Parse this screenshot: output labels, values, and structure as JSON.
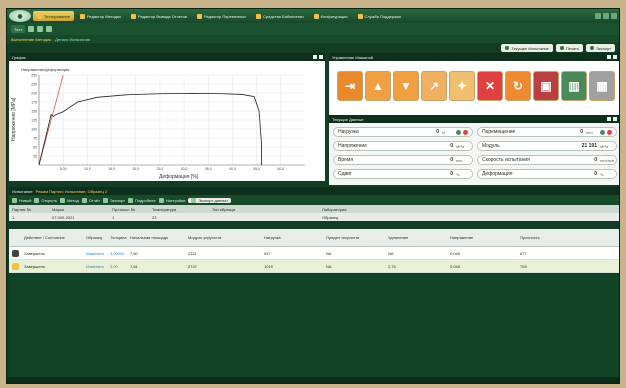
{
  "app": {
    "logo_text": "◉",
    "menu_tabs": [
      {
        "label": "Тестирование",
        "active": true
      },
      {
        "label": "Редактор Методик",
        "active": false
      },
      {
        "label": "Редактор Вывода Отчетов",
        "active": false
      },
      {
        "label": "Редактор Переменных",
        "active": false
      },
      {
        "label": "Средства Библиотеки",
        "active": false
      },
      {
        "label": "Конфигурация",
        "active": false
      },
      {
        "label": "Служба Поддержки",
        "active": false
      }
    ],
    "sub_chip": "Тест",
    "links": [
      "Выполнение Методик",
      "Детали Испытания"
    ]
  },
  "toolbar2": {
    "items": [
      "Текущее Испытание",
      "Печать",
      "Экспорт"
    ]
  },
  "graph": {
    "header": "График",
    "chart_data": {
      "type": "line",
      "title": "Напряжение/деформация",
      "xlabel": "Деформация [%]",
      "ylabel": "Напряжение [MPa]",
      "xlim": [
        0,
        55
      ],
      "ylim": [
        0,
        250
      ],
      "x_ticks": [
        "5,00",
        "10,0",
        "15,0",
        "20,0",
        "25,0",
        "30,0",
        "35,0",
        "40,0",
        "45,0",
        "50,0"
      ],
      "y_ticks": [
        "25",
        "50",
        "75",
        "100",
        "125",
        "150",
        "175",
        "200",
        "225",
        "250"
      ],
      "series": [
        {
          "x": [
            0,
            2.5,
            3.0,
            3.5,
            5,
            8,
            12,
            18,
            25,
            32,
            38,
            42,
            44.5,
            45.5,
            46.0,
            46.0
          ],
          "y": [
            0,
            140,
            135,
            140,
            148,
            175,
            188,
            195,
            198,
            199,
            198,
            196,
            190,
            150,
            60,
            0
          ]
        }
      ],
      "reference_line": {
        "x": [
          0,
          5
        ],
        "y": [
          0,
          250
        ]
      }
    }
  },
  "control": {
    "header": "Управление Машиной",
    "buttons": [
      {
        "name": "load-specimen-button",
        "glyph": "⇥",
        "color": "#e8892b"
      },
      {
        "name": "move-up-button",
        "glyph": "▲",
        "color": "#f0a040"
      },
      {
        "name": "move-down-button",
        "glyph": "▼",
        "color": "#f0a040"
      },
      {
        "name": "jog-up-button",
        "glyph": "↗",
        "color": "#f0b060"
      },
      {
        "name": "jog-fast-button",
        "glyph": "✦",
        "color": "#f0c070"
      },
      {
        "name": "stop-button",
        "glyph": "✕",
        "color": "#e04040"
      },
      {
        "name": "return-button",
        "glyph": "↻",
        "color": "#f08a30"
      },
      {
        "name": "save-button",
        "glyph": "▣",
        "color": "#b84040"
      },
      {
        "name": "record-button",
        "glyph": "▥",
        "color": "#4a8a5a"
      },
      {
        "name": "end-button",
        "glyph": "▦",
        "color": "#a0a0a0"
      }
    ]
  },
  "data": {
    "header": "Текущие Данные",
    "cells": [
      {
        "label": "Нагрузка",
        "value": "0",
        "unit": "N"
      },
      {
        "label": "Перемещение",
        "value": "0",
        "unit": "mm"
      },
      {
        "label": "Напряжение",
        "value": "0",
        "unit": "MPa"
      },
      {
        "label": "Модуль",
        "value": "21 191",
        "unit": "MPa"
      },
      {
        "label": "Время",
        "value": "0",
        "unit": "min"
      },
      {
        "label": "Скорость испытания",
        "value": "0",
        "unit": "mm/min"
      },
      {
        "label": "Сдвиг",
        "value": "0",
        "unit": "%"
      },
      {
        "label": "Деформация",
        "value": "0",
        "unit": "%"
      }
    ]
  },
  "bottom": {
    "header": "Испытание",
    "header_extra": "Режим Партии; Испытание; Образец 2",
    "toolbar": [
      "Новый",
      "Открыть",
      "Метод",
      "Отчёт",
      "Экспорт",
      "Подробнее",
      "Настройки",
      "Экспорт данных"
    ],
    "info_headers": [
      "Партия №",
      "Марка",
      "Протокол №",
      "Температура",
      "Тип образца",
      "Лаборатория"
    ],
    "info_values": [
      "1",
      "07.000-2021",
      "1",
      "23",
      "",
      "Образец"
    ],
    "results_headers": [
      "Действие / Состояние",
      "Образец",
      "Толщина",
      "Начальная площадь",
      "Модуль упругости",
      "Нагрузка",
      "Предел текучести",
      "Удлинение",
      "Напряжение",
      "Прочность"
    ],
    "rows": [
      [
        "Завершено",
        "Изменить",
        "3,00000",
        "7,50",
        "2321",
        "947",
        "NA",
        "NA",
        "0,045",
        "877"
      ],
      [
        "Завершено",
        "Изменить",
        "3,00",
        "7,61",
        "2747",
        "1019",
        "NA",
        "2,75",
        "0,045",
        "759"
      ]
    ]
  }
}
